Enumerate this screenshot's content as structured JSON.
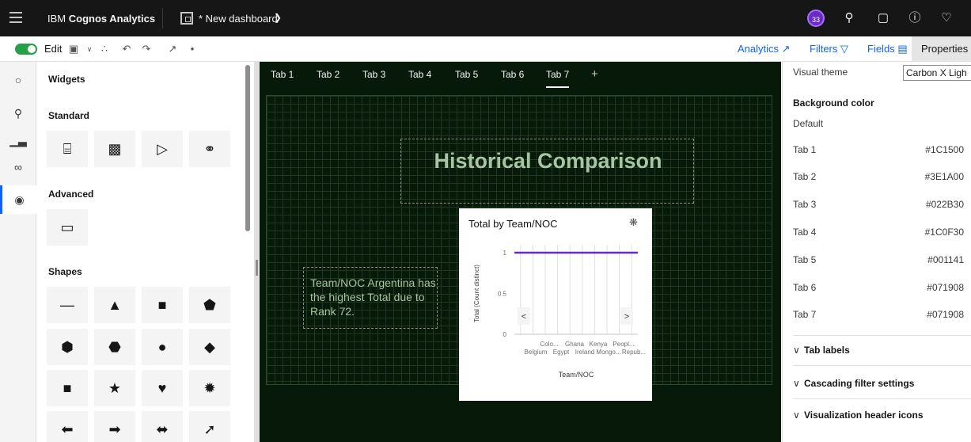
{
  "topbar": {
    "product_prefix": "IBM ",
    "product_name": "Cognos Analytics",
    "dashboard_name": "* New dashboard",
    "avatar_text": "33",
    "icons": [
      "menu-icon",
      "dashboard-icon",
      "chevron-down-icon",
      "search-icon",
      "chat-icon",
      "help-icon",
      "notification-icon"
    ]
  },
  "toolbar": {
    "edit_label": "Edit",
    "right_tabs": [
      "Analytics",
      "Filters",
      "Fields",
      "Properties"
    ],
    "active_tab": "Properties",
    "toggle_on": true
  },
  "widgets": {
    "title": "Widgets",
    "sections": {
      "standard": "Standard",
      "advanced": "Advanced",
      "shapes": "Shapes"
    },
    "standard_items": [
      "text-icon",
      "image-icon",
      "media-icon",
      "webpage-icon"
    ],
    "advanced_items": [
      "folder-icon"
    ],
    "shape_glyphs": [
      "—",
      "▲",
      "■",
      "⬟",
      "⬢",
      "⬣",
      "●",
      "◆",
      "■",
      "★",
      "♥",
      "✹",
      "⬅",
      "➡",
      "⬌",
      "➚"
    ]
  },
  "canvas": {
    "tabs": [
      "Tab 1",
      "Tab 2",
      "Tab 3",
      "Tab 4",
      "Tab 5",
      "Tab 6",
      "Tab 7"
    ],
    "active_tab": "Tab 7",
    "add_tab": "+",
    "title": "Historical Comparison",
    "insight": "Team/NOC Argentina has the highest Total due to Rank 72.",
    "background_color": "#071908"
  },
  "chart_data": {
    "type": "line",
    "title": "Total by Team/NOC",
    "xlabel": "Team/NOC",
    "ylabel": "Total (Count distinct)",
    "ylim": [
      0,
      1
    ],
    "y_ticks": [
      "0",
      "0.5",
      "1"
    ],
    "x_tick_labels_top": [
      "Colo...",
      "Ghana",
      "Kenya",
      "Peopl..."
    ],
    "x_tick_labels_bottom": [
      "Belgium",
      "Egypt",
      "Ireland",
      "Mongo...",
      "Repub..."
    ],
    "series": [
      {
        "values": [
          1,
          1,
          1,
          1,
          1,
          1,
          1,
          1,
          1,
          1
        ],
        "color": "#6929c4"
      }
    ],
    "nav_prev": "<",
    "nav_next": ">"
  },
  "properties": {
    "visual_theme_label": "Visual theme",
    "visual_theme_value": "Carbon X Ligh",
    "background_color_label": "Background color",
    "default_label": "Default",
    "tab_colors": [
      {
        "tab": "Tab 1",
        "color": "#1C1500"
      },
      {
        "tab": "Tab 2",
        "color": "#3E1A00"
      },
      {
        "tab": "Tab 3",
        "color": "#022B30"
      },
      {
        "tab": "Tab 4",
        "color": "#1C0F30"
      },
      {
        "tab": "Tab 5",
        "color": "#001141"
      },
      {
        "tab": "Tab 6",
        "color": "#071908"
      },
      {
        "tab": "Tab 7",
        "color": "#071908"
      }
    ],
    "sections": [
      "Tab labels",
      "Cascading filter settings",
      "Visualization header icons"
    ]
  }
}
